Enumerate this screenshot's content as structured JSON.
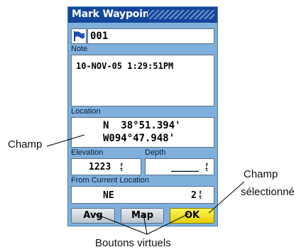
{
  "window": {
    "title": "Mark Waypoint"
  },
  "waypoint": {
    "icon": "flag-icon",
    "name": "001"
  },
  "note": {
    "label": "Note",
    "value": "10-NOV-05 1:29:51PM"
  },
  "location": {
    "label": "Location",
    "lat": "N  38°51.394'",
    "lon": "W094°47.948'"
  },
  "elevation": {
    "label": "Elevation",
    "value": "1223",
    "unit": "ft"
  },
  "depth": {
    "label": "Depth",
    "value": "_____",
    "unit": "ft"
  },
  "from_current": {
    "label": "From Current Location",
    "bearing": "NE",
    "distance": "2",
    "unit": "ft"
  },
  "buttons": {
    "avg": "Avg",
    "map": "Map",
    "ok": "OK"
  },
  "annotations": {
    "field": "Champ",
    "selected_field_line1": "Champ",
    "selected_field_line2": "sélectionné",
    "virtual_buttons": "Boutons virtuels"
  },
  "colors": {
    "title_bar": "#14479a",
    "screen": "#7fb0dc",
    "selected_button": "#f5e51a"
  }
}
